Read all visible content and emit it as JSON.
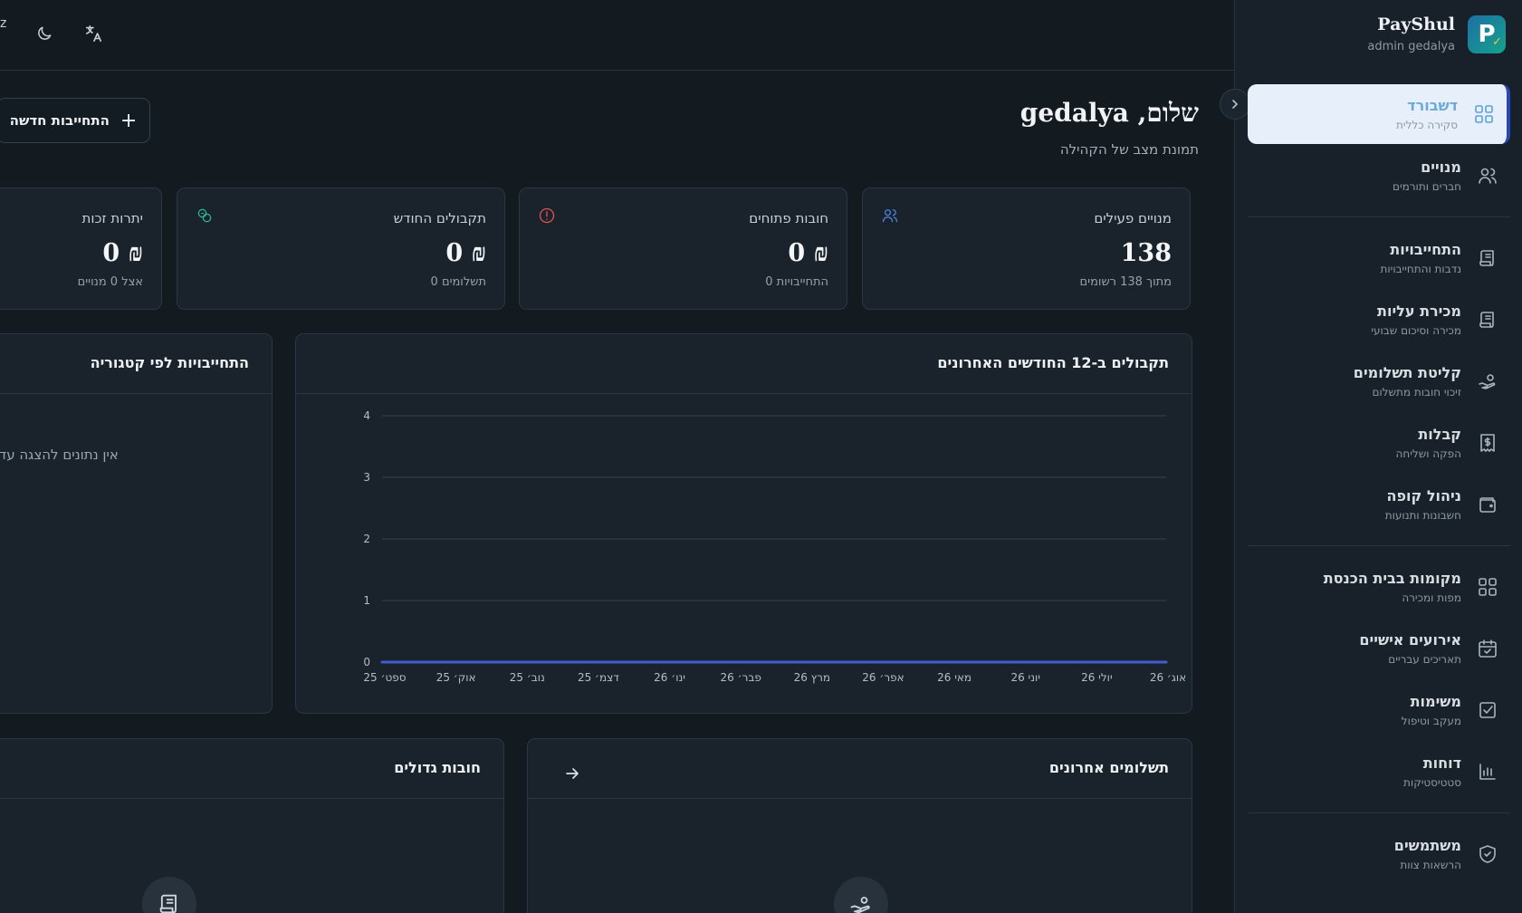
{
  "brand": {
    "name": "PayShul",
    "user": "admin gedalya",
    "logo_letter": "P"
  },
  "nav": [
    {
      "label": "דשבורד",
      "sub": "סקירה כללית",
      "icon": "dashboard-grid-icon",
      "active": true
    },
    {
      "label": "מנויים",
      "sub": "חברים ותורמים",
      "icon": "users-icon"
    },
    {
      "label": "התחייבויות",
      "sub": "נדבות והתחייבויות",
      "icon": "scroll-icon"
    },
    {
      "label": "מכירת עליות",
      "sub": "מכירה וסיכום שבועי",
      "icon": "scroll-icon"
    },
    {
      "label": "קליטת תשלומים",
      "sub": "זיכוי חובות מתשלום",
      "icon": "hand-coins-icon"
    },
    {
      "label": "קבלות",
      "sub": "הפקה ושליחה",
      "icon": "receipt-icon"
    },
    {
      "label": "ניהול קופה",
      "sub": "חשבונות ותנועות",
      "icon": "wallet-icon"
    },
    {
      "label": "מקומות בבית הכנסת",
      "sub": "מפות ומכירה",
      "icon": "seats-grid-icon"
    },
    {
      "label": "אירועים אישיים",
      "sub": "תאריכים עבריים",
      "icon": "calendar-icon"
    },
    {
      "label": "משימות",
      "sub": "מעקב וטיפול",
      "icon": "check-square-icon"
    },
    {
      "label": "דוחות",
      "sub": "סטטיסטיקות",
      "icon": "bar-chart-icon"
    },
    {
      "label": "משתמשים",
      "sub": "הרשאות צוות",
      "icon": "shield-icon"
    }
  ],
  "topbar": {
    "partial_text": "z"
  },
  "header": {
    "greeting": "שלום, gedalya",
    "subtitle": "תמונת מצב של הקהילה",
    "new_button": "התחייבות חדשה"
  },
  "stats": [
    {
      "title": "מנויים פעילים",
      "value": "138",
      "sub": "מתוך 138 רשומים",
      "icon": "users-icon",
      "color": "#4f7fd6"
    },
    {
      "title": "חובות פתוחים",
      "value": "0 ₪",
      "sub": "0 התחייבויות",
      "icon": "alert-circle-icon",
      "color": "#e0524f"
    },
    {
      "title": "תקבולים החודש",
      "value": "0 ₪",
      "sub": "0 תשלומים",
      "icon": "coins-icon",
      "color": "#2fb08a"
    },
    {
      "title": "יתרות זכות",
      "value": "0 ₪",
      "sub": "אצל 0 מנויים",
      "icon": "",
      "color": ""
    }
  ],
  "sections": {
    "chart_title": "תקבולים ב-12 החודשים האחרונים",
    "category_title": "התחייבויות לפי קטגוריה",
    "category_empty": "אין נתונים להצגה עד",
    "payments_title": "תשלומים אחרונים",
    "debts_title": "חובות גדולים"
  },
  "chart_data": {
    "type": "line",
    "title": "תקבולים ב-12 החודשים האחרונים",
    "xlabel": "",
    "ylabel": "",
    "categories": [
      "ספט׳ 25",
      "אוק׳ 25",
      "נוב׳ 25",
      "דצמ׳ 25",
      "ינו׳ 26",
      "פבר׳ 26",
      "מרץ 26",
      "אפר׳ 26",
      "מאי 26",
      "יוני 26",
      "יולי 26",
      "אוג׳ 26"
    ],
    "series": [
      {
        "values": [
          0,
          0,
          0,
          0,
          0,
          0,
          0,
          0,
          0,
          0,
          0,
          0
        ],
        "color": "#3f5fd0"
      }
    ],
    "ylim": [
      0,
      4
    ],
    "yticks": [
      0,
      1,
      2,
      3,
      4
    ],
    "grid": true,
    "legend": "none"
  }
}
